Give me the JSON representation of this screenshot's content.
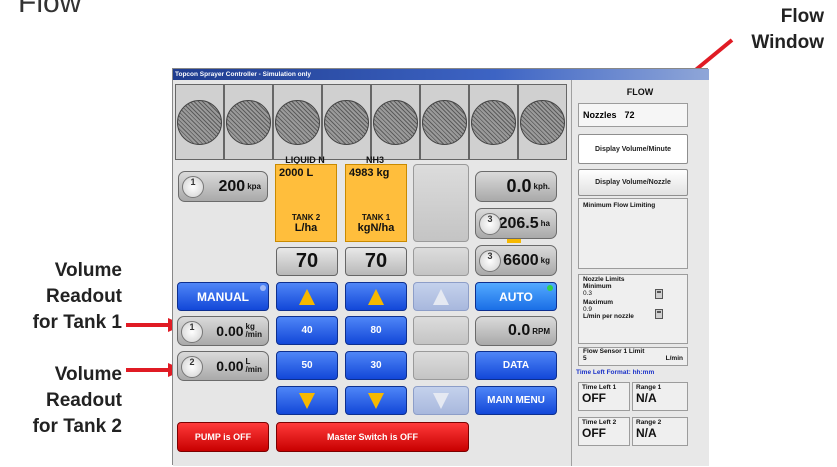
{
  "page": {
    "caption": "Flow",
    "callouts": {
      "flow_window": [
        "Flow",
        "Window"
      ],
      "tank1_readout": [
        "Volume",
        "Readout",
        "for Tank 1"
      ],
      "tank2_readout": [
        "Volume",
        "Readout",
        "for Tank 2"
      ]
    },
    "colors": {
      "arrow": "#e01b24",
      "tank": "#ffbe3c",
      "blue_button": "#1f5de8",
      "red_button": "#d80000"
    }
  },
  "window": {
    "title": "Topcon Sprayer Controller - Simulation only"
  },
  "pressure": {
    "dial": "1",
    "value": "200",
    "unit": "kpa"
  },
  "tanks": [
    {
      "product": "LIQUID N",
      "amount": "2000 L",
      "tank": "TANK 2",
      "rate_unit": "L/ha",
      "rate": "70",
      "preset_a": "40",
      "preset_b": "50"
    },
    {
      "product": "NH3",
      "amount": "4983 kg",
      "tank": "TANK 1",
      "rate_unit": "kgN/ha",
      "rate": "70",
      "preset_a": "80",
      "preset_b": "30"
    }
  ],
  "speed": {
    "value": "0.0",
    "unit": "kph."
  },
  "area": {
    "dial": "3",
    "value": "206.5",
    "unit": "ha"
  },
  "weight": {
    "dial": "3",
    "value": "6600",
    "unit": "kg"
  },
  "rpm": {
    "value": "0.0",
    "unit": "RPM"
  },
  "volume_readouts": [
    {
      "dial": "1",
      "value": "0.00",
      "unit_top": "kg",
      "unit_bottom": "/min"
    },
    {
      "dial": "2",
      "value": "0.00",
      "unit_top": "L",
      "unit_bottom": "/min"
    }
  ],
  "buttons": {
    "manual": "MANUAL",
    "auto": "AUTO",
    "data": "DATA",
    "main_menu": "MAIN MENU",
    "pump": "PUMP is OFF",
    "master_switch": "Master Switch is OFF"
  },
  "icons": {
    "up": "up-arrow-icon",
    "down": "down-arrow-icon",
    "nozzle": "nozzle-icon"
  },
  "flow_panel": {
    "title": "FLOW",
    "nozzles_label": "Nozzles",
    "nozzles_value": "72",
    "display_volume_minute": "Display Volume/Minute",
    "display_volume_nozzle": "Display Volume/Nozzle",
    "minimum_flow_limiting": "Minimum Flow Limiting",
    "nozzle_limits": "Nozzle Limits",
    "minimum_label": "Minimum",
    "minimum_value": "0.3",
    "maximum_label": "Maximum",
    "maximum_value": "0.9",
    "per_nozzle": "L/min per nozzle",
    "flow_sensor": "Flow Sensor 1 Limit",
    "flow_sensor_value": "5",
    "flow_sensor_unit": "L/min",
    "time_format": "Time Left Format: hh:mm",
    "time_left_1": "Time Left 1",
    "time_left_1_value": "OFF",
    "range_1": "Range 1",
    "range_1_value": "N/A",
    "time_left_2": "Time Left 2",
    "time_left_2_value": "OFF",
    "range_2": "Range 2",
    "range_2_value": "N/A"
  }
}
